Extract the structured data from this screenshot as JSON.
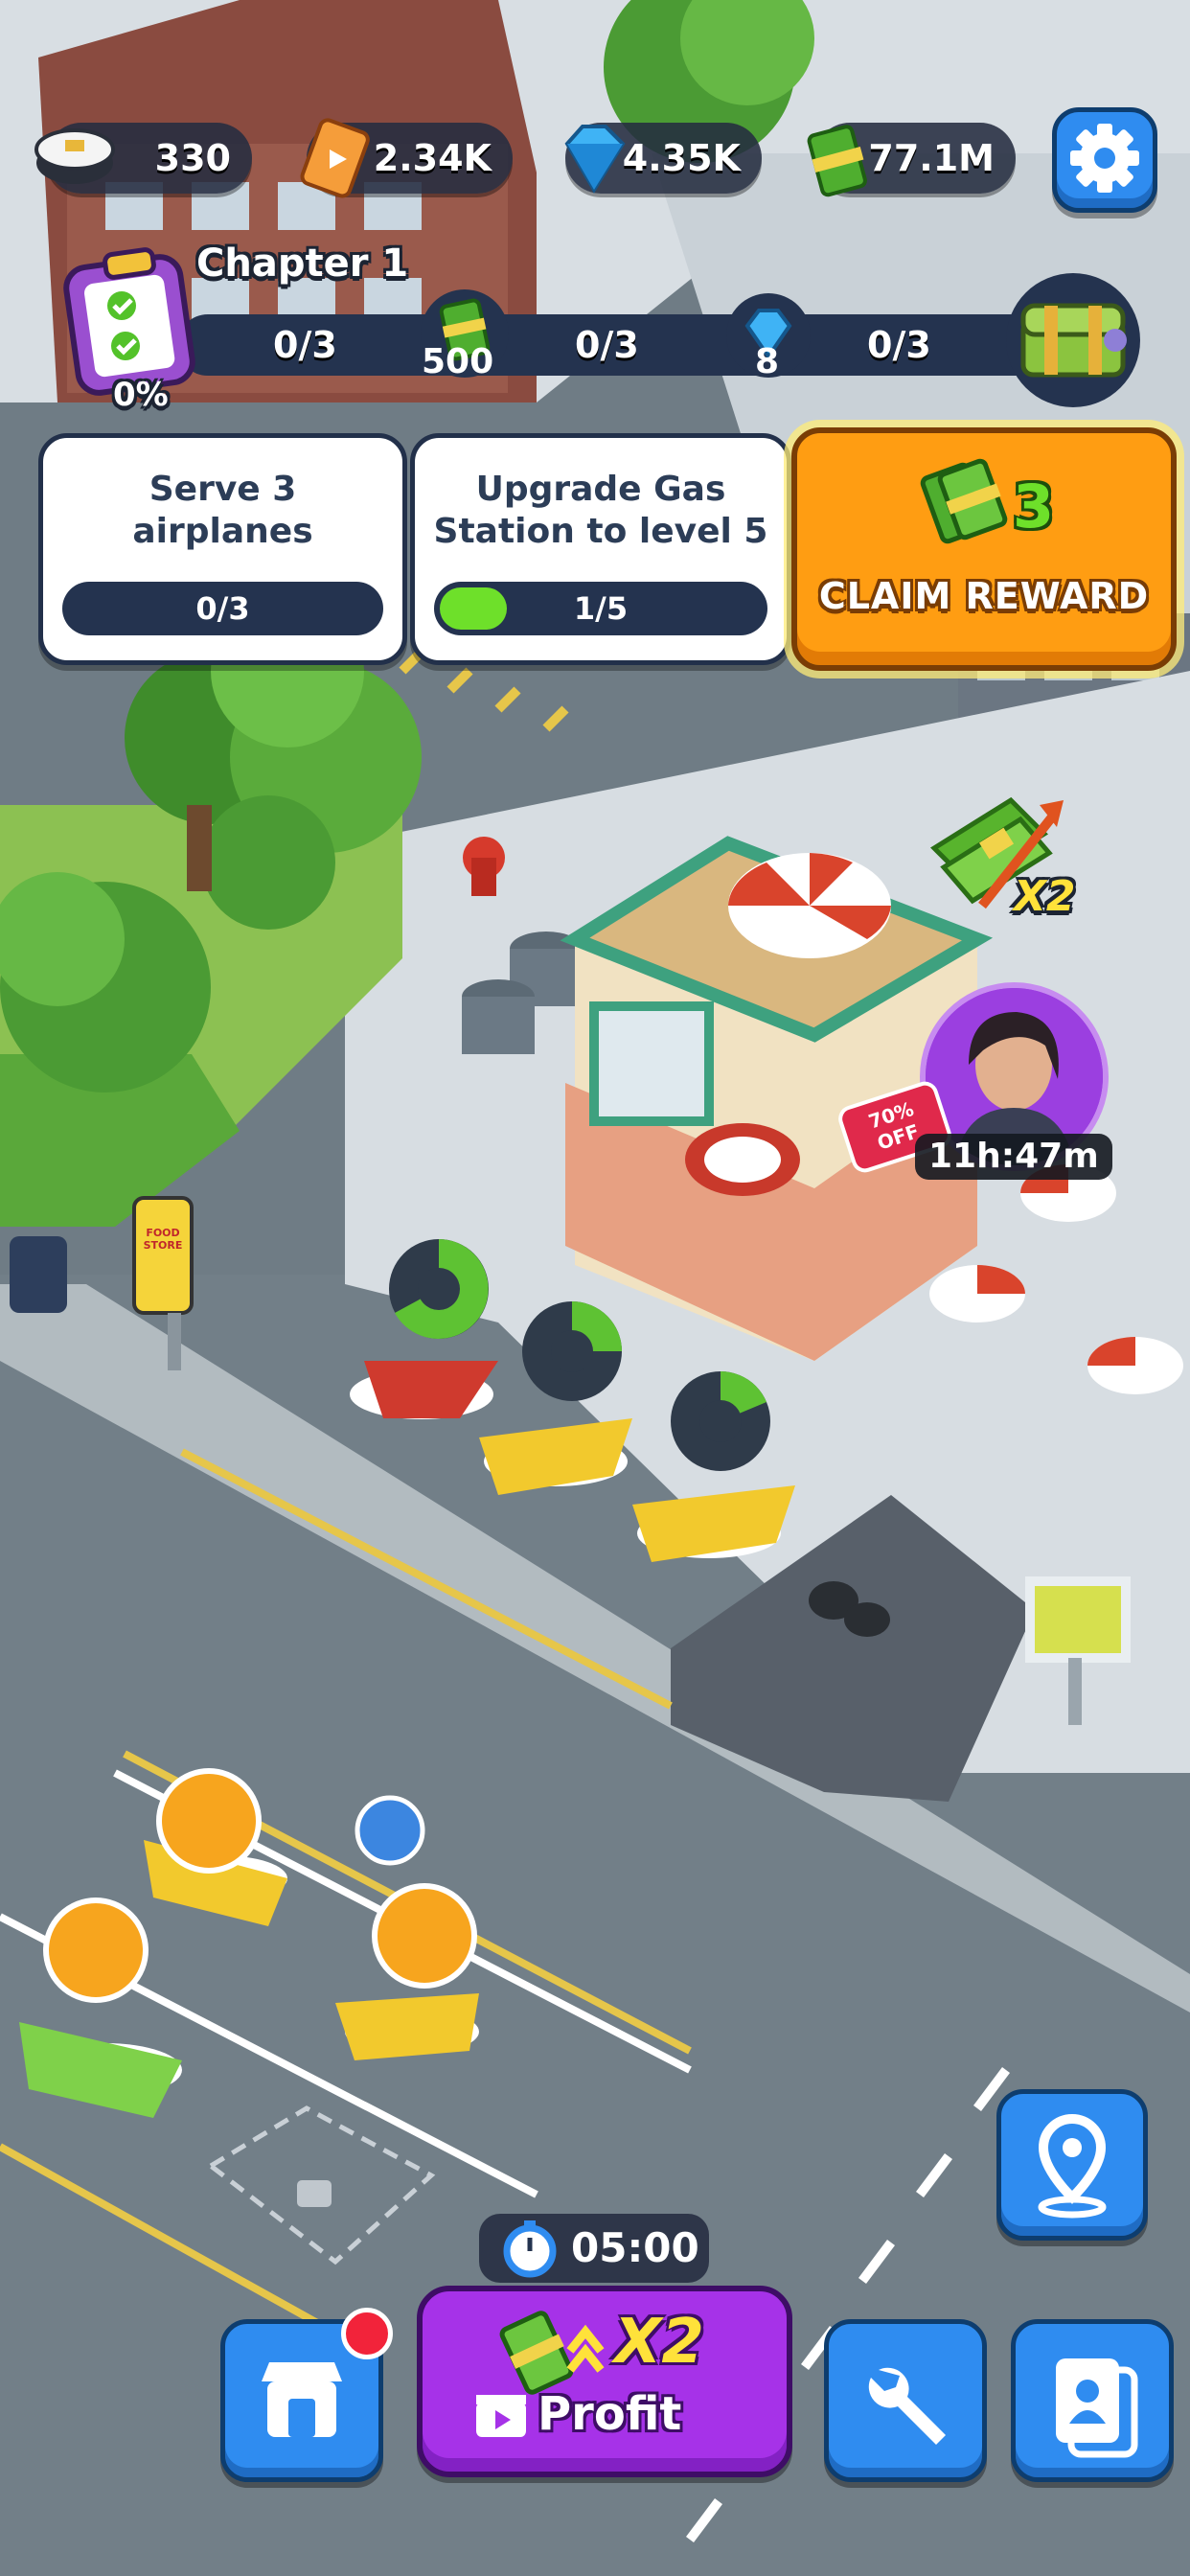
{
  "hud": {
    "pilots": "330",
    "tickets": "2.34K",
    "gems": "4.35K",
    "cash": "77.1M"
  },
  "chapter": {
    "title": "Chapter 1",
    "percent": "0%",
    "progress": 0,
    "milestones": [
      {
        "progress": "0/3",
        "reward": "500",
        "reward_icon": "cash-icon"
      },
      {
        "progress": "0/3",
        "reward": "8",
        "reward_icon": "gem-icon"
      },
      {
        "progress": "0/3",
        "reward": "",
        "reward_icon": "treasure-chest-icon"
      }
    ]
  },
  "tasks": [
    {
      "title": "Serve 3 airplanes",
      "progress": "0/3",
      "fraction": 0
    },
    {
      "title": "Upgrade Gas Station to level 5",
      "progress": "1/5",
      "fraction": 0.2
    }
  ],
  "claim": {
    "amount": "3",
    "label": "CLAIM REWARD"
  },
  "map": {
    "cash_boost_label": "X2",
    "offer_badge": "70% OFF",
    "offer_timer": "11h:47m",
    "store_sign": "FOOD STORE"
  },
  "bottom_bar": {
    "timer": "05:00",
    "profit_multiplier": "X2",
    "profit_label": "Profit"
  },
  "colors": {
    "accent_blue": "#2f8cf0",
    "claim_orange": "#ff9d12",
    "profit_purple": "#a632e8",
    "progress_green": "#6ee02a",
    "hud_bg": "#242c40"
  }
}
